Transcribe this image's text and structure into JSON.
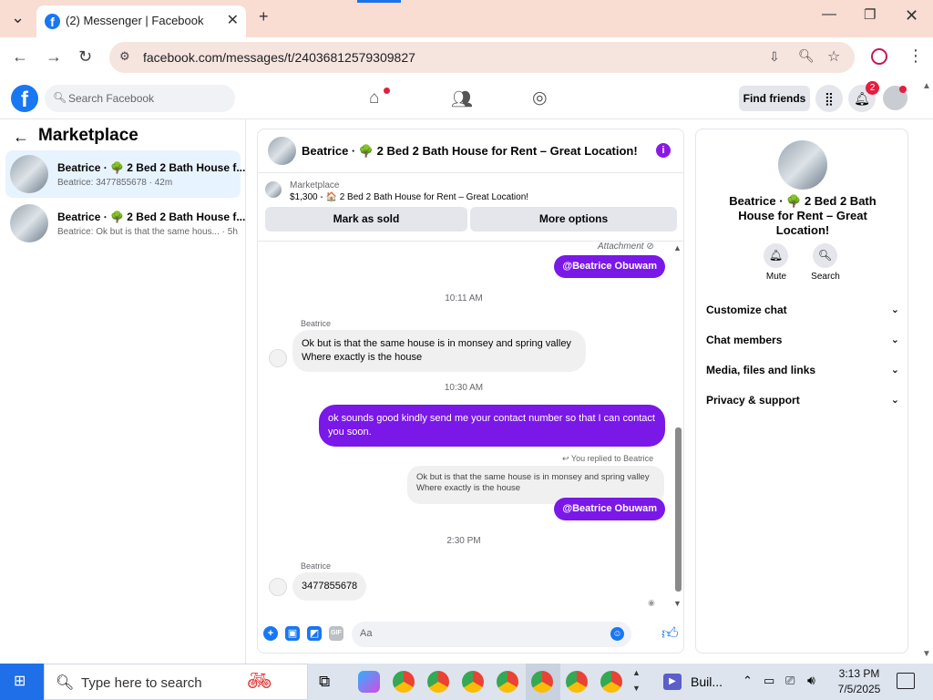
{
  "browser": {
    "tab_title": "(2) Messenger | Facebook",
    "url": "facebook.com/messages/t/24036812579309827"
  },
  "fb": {
    "search_placeholder": "Search Facebook",
    "find_friends": "Find friends",
    "notification_count": "2"
  },
  "left": {
    "title": "Marketplace",
    "conversations": [
      {
        "name": "Beatrice · 🌳 2 Bed 2 Bath House f...",
        "sub": "Beatrice: 3477855678 · 42m"
      },
      {
        "name": "Beatrice · 🌳 2 Bed 2 Bath House f...",
        "sub": "Beatrice: Ok but is that the same hous... · 5h"
      }
    ]
  },
  "chat": {
    "title": "Beatrice · 🌳 2 Bed 2 Bath House for Rent – Great Location!",
    "marketplace_label": "Marketplace",
    "listing": "$1,300 - 🏠 2 Bed 2 Bath House for Rent – Great Location!",
    "mark_sold": "Mark as sold",
    "more_options": "More options",
    "attachment": "Attachment",
    "mention": "@Beatrice Obuwam",
    "time1": "10:11 AM",
    "sender": "Beatrice",
    "msg1_line1": "Ok but is that the same house is in monsey and spring valley",
    "msg1_line2": "Where exactly is the house",
    "time2": "10:30 AM",
    "out_msg": "ok sounds good kindly send me your contact number so that I can contact you soon.",
    "replied": "You replied to Beatrice",
    "quote_line1": "Ok but is that the same house is in monsey and spring valley",
    "quote_line2": "Where exactly is the house",
    "mention2": "@Beatrice Obuwam",
    "time3": "2:30 PM",
    "sender2": "Beatrice",
    "msg2": "3477855678",
    "composer_placeholder": "Aa"
  },
  "right": {
    "title": "Beatrice · 🌳 2 Bed 2 Bath House for Rent – Great Location!",
    "mute": "Mute",
    "search": "Search",
    "sections": [
      "Customize chat",
      "Chat members",
      "Media, files and links",
      "Privacy & support"
    ]
  },
  "taskbar": {
    "search_placeholder": "Type here to search",
    "app_label": "Buil...",
    "time": "3:13 PM",
    "date": "7/5/2025"
  }
}
